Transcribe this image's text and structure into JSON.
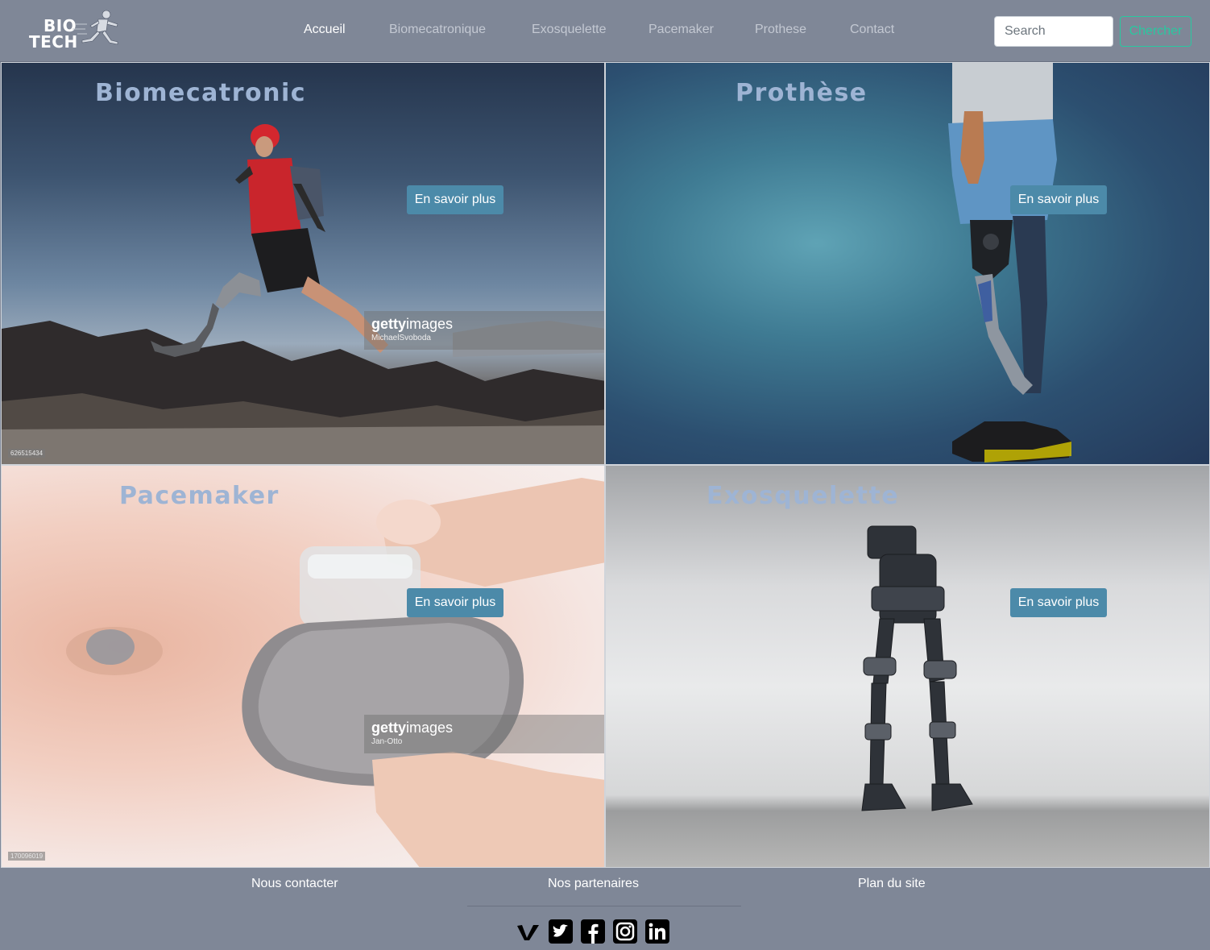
{
  "header": {
    "logo": {
      "line1": "BIO",
      "line2": "TECH"
    },
    "nav": [
      {
        "label": "Accueil",
        "active": true
      },
      {
        "label": "Biomecatronique",
        "active": false
      },
      {
        "label": "Exosquelette",
        "active": false
      },
      {
        "label": "Pacemaker",
        "active": false
      },
      {
        "label": "Prothese",
        "active": false
      },
      {
        "label": "Contact",
        "active": false
      }
    ],
    "search": {
      "placeholder": "Search",
      "value": "",
      "button_label": "Chercher"
    }
  },
  "tiles": [
    {
      "title": "Biomecatronic",
      "cta": "En savoir plus",
      "watermark": {
        "brand_bold": "getty",
        "brand_rest": "images",
        "credit": "MichaelSvoboda"
      },
      "image_id": "626515434"
    },
    {
      "title": "Prothèse",
      "cta": "En savoir plus"
    },
    {
      "title": "Pacemaker",
      "cta": "En savoir plus",
      "watermark": {
        "brand_bold": "getty",
        "brand_rest": "images",
        "credit": "Jan-Otto"
      },
      "image_id": "170096019"
    },
    {
      "title": "Exosquelette",
      "cta": "En savoir plus"
    }
  ],
  "footer": {
    "links": [
      "Nous contacter",
      "Nos partenaires",
      "Plan du site"
    ],
    "socials": [
      "vimeo-icon",
      "twitter-icon",
      "facebook-icon",
      "instagram-icon",
      "linkedin-icon"
    ]
  },
  "colors": {
    "nav_bg": "#7f8797",
    "accent_button": "#4c8aa9",
    "search_button": "#28c9a0",
    "tile_title": "#9eb4d4"
  }
}
